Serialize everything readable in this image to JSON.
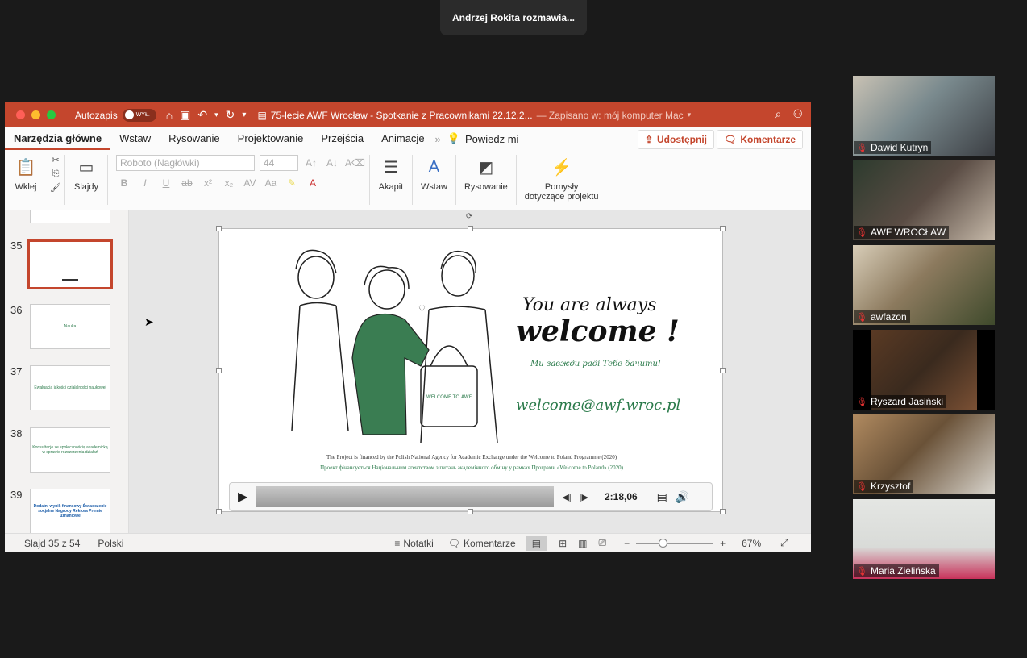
{
  "toast": "Andrzej Rokita rozmawia...",
  "window": {
    "autosave_label": "Autozapis",
    "autosave_state": "WYŁ.",
    "doc_title": "75-lecie AWF Wrocław - Spotkanie z Pracownikami 22.12.2...",
    "saved_label": "— Zapisano w: mój komputer Mac"
  },
  "tabs": [
    "Narzędzia główne",
    "Wstaw",
    "Rysowanie",
    "Projektowanie",
    "Przejścia",
    "Animacje"
  ],
  "tell_me": "Powiedz mi",
  "share_label": "Udostępnij",
  "comments_label": "Komentarze",
  "ribbon": {
    "paste": "Wklej",
    "slides": "Slajdy",
    "font_name": "Roboto (Nagłówki)",
    "font_size": "44",
    "paragraph": "Akapit",
    "insert": "Wstaw",
    "drawing": "Rysowanie",
    "ideas_line1": "Pomysły",
    "ideas_line2": "dotyczące projektu"
  },
  "thumbs": [
    {
      "num": "35",
      "text": ""
    },
    {
      "num": "36",
      "text": "Nauka"
    },
    {
      "num": "37",
      "text": "Ewaluacja jakości działalności naukowej"
    },
    {
      "num": "38",
      "text": "Konsultacje ze społecznością akademicką w sprawie rozszerzenia działań"
    },
    {
      "num": "39",
      "text": "Dodatni wynik finansowy Świadczenie socjalne Nagrody Rektora Premie uznaniowe"
    }
  ],
  "slide": {
    "line1": "You are always",
    "line2": "welcome !",
    "ukr": "Ми завжди раді Тебе бачити!",
    "email": "welcome@awf.wroc.pl",
    "footer_en": "The Project is financed by the Polish National Agency for Academic Exchange under the Welcome to Poland Programme (2020)",
    "footer_ua": "Проект фінансується Національним агентством з питань академічного обміну у рамках Програми «Welcome to Poland» (2020)",
    "bag_text": "WELCOME TO AWF",
    "time": "2:18,06"
  },
  "status": {
    "slide": "Slajd 35 z 54",
    "lang": "Polski",
    "notes": "Notatki",
    "comments": "Komentarze",
    "zoom": "67%"
  },
  "participants": [
    {
      "name": "Dawid Kutryn",
      "bg": "#7a8a8e"
    },
    {
      "name": "AWF WROCŁAW",
      "bg": "#5a4c44"
    },
    {
      "name": "awfazon",
      "bg": "#8c7a5e"
    },
    {
      "name": "Ryszard Jasiński",
      "bg": "#3a2a1e"
    },
    {
      "name": "Krzysztof",
      "bg": "#6a5238"
    },
    {
      "name": "Maria Zielińska",
      "bg": "#d9dbd8"
    }
  ]
}
